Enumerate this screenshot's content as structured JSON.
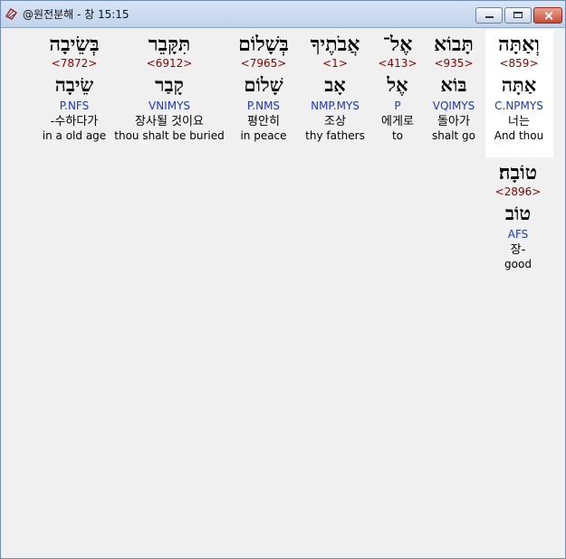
{
  "window": {
    "title": "@원전분해 - 창 15:15"
  },
  "words": [
    {
      "hebrew": "וְאַתָּה",
      "strong": "<859>",
      "root": "אַתָּה",
      "morph": "C.NPMYS",
      "korean": "너는",
      "english": "And thou"
    },
    {
      "hebrew": "תָּבוֹא",
      "strong": "<935>",
      "root": "בּוֹא",
      "morph": "VQIMYS",
      "korean": "돌아가",
      "english": "shalt go"
    },
    {
      "hebrew": "אֶל־",
      "strong": "<413>",
      "root": "אֶל",
      "morph": "P",
      "korean": "에게로",
      "english": "to"
    },
    {
      "hebrew": "אֲבֹתֶיךָ",
      "strong": "<1>",
      "root": "אָב",
      "morph": "NMP.MYS",
      "korean": "조상",
      "english": "thy fathers"
    },
    {
      "hebrew": "בְּשָׁלוֹם",
      "strong": "<7965>",
      "root": "שָׁלוֹם",
      "morph": "P.NMS",
      "korean": "평안히",
      "english": "in peace"
    },
    {
      "hebrew": "תִּקָּבֵר",
      "strong": "<6912>",
      "root": "קָבַר",
      "morph": "VNIMYS",
      "korean": "장사될 것이요",
      "english": "thou shalt be buried"
    },
    {
      "hebrew": "בְּשֵׂיבָה",
      "strong": "<7872>",
      "root": "שֵׂיבָה",
      "morph": "P.NFS",
      "korean": "-수하다가",
      "english": "in a old age"
    },
    {
      "hebrew": "טוֹבָה׃",
      "strong": "<2896>",
      "root": "טוֹב",
      "morph": "AFS",
      "korean": "장-",
      "english": "good"
    }
  ]
}
